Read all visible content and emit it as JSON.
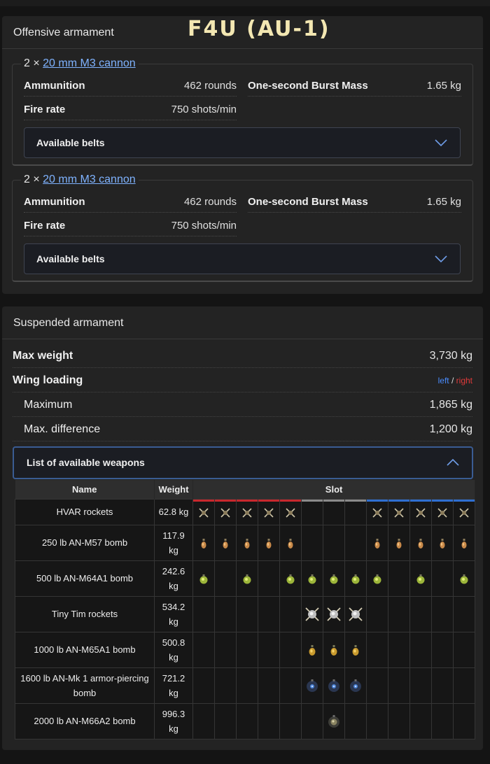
{
  "overlay_title": "F4U (AU-1)",
  "offensive": {
    "header": "Offensive armament",
    "weapons": [
      {
        "count": "2 ×",
        "name": "20 mm M3 cannon",
        "ammo_label": "Ammunition",
        "ammo_value": "462 rounds",
        "burst_label": "One-second Burst Mass",
        "burst_value": "1.65 kg",
        "fire_label": "Fire rate",
        "fire_value": "750 shots/min",
        "belts_label": "Available belts"
      },
      {
        "count": "2 ×",
        "name": "20 mm M3 cannon",
        "ammo_label": "Ammunition",
        "ammo_value": "462 rounds",
        "burst_label": "One-second Burst Mass",
        "burst_value": "1.65 kg",
        "fire_label": "Fire rate",
        "fire_value": "750 shots/min",
        "belts_label": "Available belts"
      }
    ]
  },
  "suspended": {
    "header": "Suspended armament",
    "max_weight_label": "Max weight",
    "max_weight_value": "3,730 kg",
    "wing_loading_label": "Wing loading",
    "wing_left": "left",
    "wing_sep": " / ",
    "wing_right": "right",
    "maximum_label": "Maximum",
    "maximum_value": "1,865 kg",
    "maxdiff_label": "Max. difference",
    "maxdiff_value": "1,200 kg",
    "list_label": "List of available weapons",
    "table": {
      "col_name": "Name",
      "col_weight": "Weight",
      "col_slot": "Slot",
      "rows": [
        {
          "name": "HVAR rockets",
          "weight": "62.8 kg",
          "icon": "rocket-icon",
          "slots": [
            1,
            1,
            1,
            1,
            1,
            0,
            0,
            0,
            1,
            1,
            1,
            1,
            1
          ]
        },
        {
          "name": "250 lb AN-M57 bomb",
          "weight": "117.9 kg",
          "icon": "small-bomb-icon",
          "slots": [
            1,
            1,
            1,
            1,
            1,
            0,
            0,
            0,
            1,
            1,
            1,
            1,
            1
          ]
        },
        {
          "name": "500 lb AN-M64A1 bomb",
          "weight": "242.6 kg",
          "icon": "medium-bomb-icon",
          "slots": [
            1,
            0,
            1,
            0,
            1,
            1,
            1,
            1,
            1,
            0,
            1,
            0,
            1
          ]
        },
        {
          "name": "Tiny Tim rockets",
          "weight": "534.2 kg",
          "icon": "large-rocket-icon",
          "slots": [
            0,
            0,
            0,
            0,
            0,
            1,
            1,
            1,
            0,
            0,
            0,
            0,
            0
          ]
        },
        {
          "name": "1000 lb AN-M65A1 bomb",
          "weight": "500.8 kg",
          "icon": "heavy-bomb-icon",
          "slots": [
            0,
            0,
            0,
            0,
            0,
            1,
            1,
            1,
            0,
            0,
            0,
            0,
            0
          ]
        },
        {
          "name": "1600 lb AN-Mk 1 armor-piercing bomb",
          "weight": "721.2 kg",
          "icon": "ap-bomb-icon",
          "slots": [
            0,
            0,
            0,
            0,
            0,
            1,
            1,
            1,
            0,
            0,
            0,
            0,
            0
          ]
        },
        {
          "name": "2000 lb AN-M66A2 bomb",
          "weight": "996.3 kg",
          "icon": "huge-bomb-icon",
          "slots": [
            0,
            0,
            0,
            0,
            0,
            0,
            1,
            0,
            0,
            0,
            0,
            0,
            0
          ]
        }
      ]
    }
  },
  "colors": {
    "link": "#7fb3ff",
    "left": "#4a8dff",
    "right": "#e03a3a",
    "slot_left_bar": "#c8282d",
    "slot_center_bar": "#8a8a8a",
    "slot_right_bar": "#2f6fd1"
  }
}
